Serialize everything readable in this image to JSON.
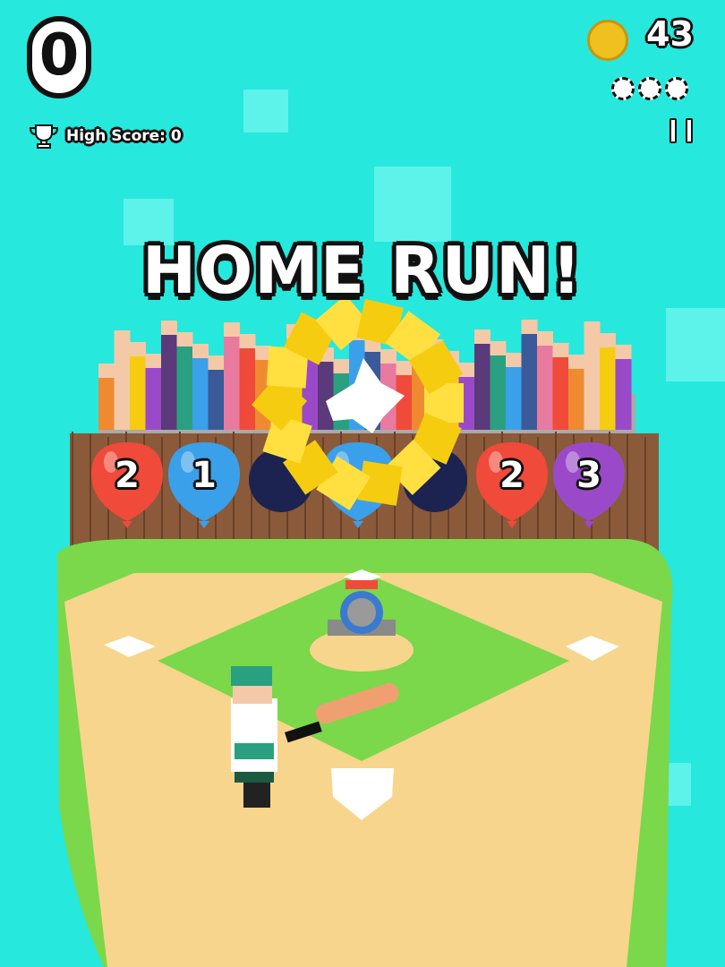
{
  "hud": {
    "score": "0",
    "high_score_label": "High Score: 0",
    "coins": "43",
    "balls_remaining": 3
  },
  "banner": {
    "text": "HOME RUN!"
  },
  "balloons": [
    {
      "label": "2",
      "color": "#f04a3a"
    },
    {
      "label": "1",
      "color": "#3aa0ea"
    },
    {
      "label": "",
      "color": "#1c2350",
      "kind": "bomb"
    },
    {
      "label": "",
      "color": "#3aa0ea",
      "note": "hit by ball"
    },
    {
      "label": "",
      "color": "#1c2350",
      "kind": "bomb"
    },
    {
      "label": "2",
      "color": "#f04a3a"
    },
    {
      "label": "3",
      "color": "#9a4ac8"
    }
  ],
  "colors": {
    "sky": "#27e8dc",
    "field_grass": "#7ad84a",
    "infield_dirt": "#f7d58c",
    "fence": "#8a5a3a",
    "coin": "#f0c020",
    "burst": "#f5cc10"
  },
  "icons": [
    "trophy-icon",
    "coin-icon",
    "ball-icon",
    "pause-icon"
  ]
}
